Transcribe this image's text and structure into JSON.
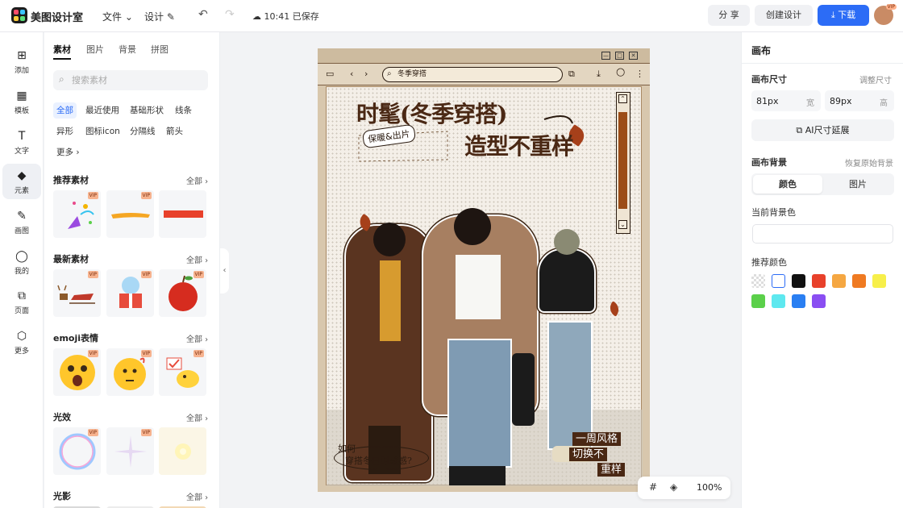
{
  "header": {
    "app_name": "美图设计室",
    "menu_file": "文件",
    "menu_design": "设计",
    "save_status": "10:41 已保存",
    "share": "分 享",
    "create_design": "创建设计",
    "download": "下载",
    "avatar_badge": "VIP"
  },
  "rail": {
    "items": [
      {
        "label": "添加",
        "icon": "plus-square-icon"
      },
      {
        "label": "模板",
        "icon": "template-icon"
      },
      {
        "label": "文字",
        "icon": "text-icon"
      },
      {
        "label": "元素",
        "icon": "shapes-icon"
      },
      {
        "label": "画图",
        "icon": "pencil-icon"
      },
      {
        "label": "我的",
        "icon": "user-icon"
      },
      {
        "label": "页面",
        "icon": "page-add-icon"
      },
      {
        "label": "更多",
        "icon": "cube-icon"
      }
    ]
  },
  "panel": {
    "tabs": [
      "素材",
      "图片",
      "背景",
      "拼图"
    ],
    "search_placeholder": "搜索素材",
    "chips": [
      "全部",
      "最近使用",
      "基础形状",
      "线条",
      "异形",
      "图标icon",
      "分隔线",
      "箭头",
      "更多"
    ],
    "sections": [
      {
        "title": "推荐素材",
        "all": "全部"
      },
      {
        "title": "最新素材",
        "all": "全部"
      },
      {
        "title": "emoji表情",
        "all": "全部"
      },
      {
        "title": "光效",
        "all": "全部"
      },
      {
        "title": "光影",
        "all": "全部"
      }
    ],
    "vip_badge": "VIP"
  },
  "poster": {
    "url_text": "冬季穿搭",
    "title_line1": "时髦(冬季穿搭)",
    "title_line2": "造型不重样",
    "tag_warm": "保暖&出片",
    "question_line1": "如何",
    "question_line2": "穿搭冬日时髦感?",
    "stamp1": "一周风格",
    "stamp2": "切换不",
    "stamp3": "重样"
  },
  "zoom": {
    "value": "100%"
  },
  "right_panel": {
    "title": "画布",
    "canvas_size_label": "画布尺寸",
    "adjust_size": "调整尺寸",
    "width_value": "81px",
    "width_unit": "宽",
    "height_value": "89px",
    "height_unit": "高",
    "ai_extend": "AI尺寸延展",
    "bg_label": "画布背景",
    "restore_bg": "恢复原始背景",
    "seg_color": "颜色",
    "seg_image": "图片",
    "current_bg_label": "当前背景色",
    "recommended_label": "推荐颜色",
    "swatches": [
      "transparent",
      "#ffffff",
      "#111111",
      "#e8412b",
      "#f5a742",
      "#ef7a22",
      "#f7ef4a",
      "#5bd04a",
      "#5ee8ef",
      "#2a7ff2",
      "#8a4ef2"
    ]
  }
}
